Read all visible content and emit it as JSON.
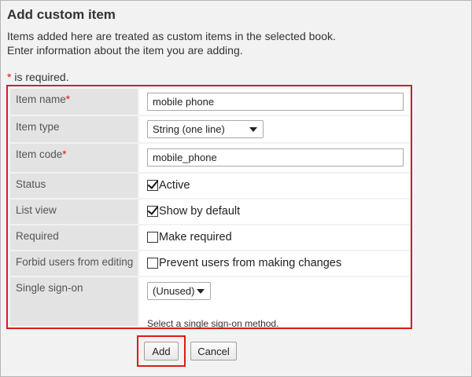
{
  "page": {
    "title": "Add custom item",
    "description_line1": "Items added here are treated as custom items in the selected book.",
    "description_line2": "Enter information about the item you are adding.",
    "required_star": "*",
    "required_note": " is required."
  },
  "form": {
    "item_name": {
      "label": "Item name",
      "required": "*",
      "value": "mobile phone"
    },
    "item_type": {
      "label": "Item type",
      "selected": "String (one line)"
    },
    "item_code": {
      "label": "Item code",
      "required": "*",
      "value": "mobile_phone"
    },
    "status": {
      "label": "Status",
      "checkbox_label": "Active",
      "checked": true
    },
    "list_view": {
      "label": "List view",
      "checkbox_label": "Show by default",
      "checked": true
    },
    "required": {
      "label": "Required",
      "checkbox_label": "Make required",
      "checked": false
    },
    "forbid_editing": {
      "label": "Forbid users from editing",
      "checkbox_label": "Prevent users from making changes",
      "checked": false
    },
    "single_sign_on": {
      "label": "Single sign-on",
      "selected": "(Unused)",
      "hint": "Select a single sign-on method."
    }
  },
  "buttons": {
    "add": "Add",
    "cancel": "Cancel"
  },
  "colors": {
    "highlight": "#dd1b1b",
    "required_star": "#e01010",
    "label_bg": "#e3e3e3",
    "page_bg": "#f2f2f2"
  }
}
